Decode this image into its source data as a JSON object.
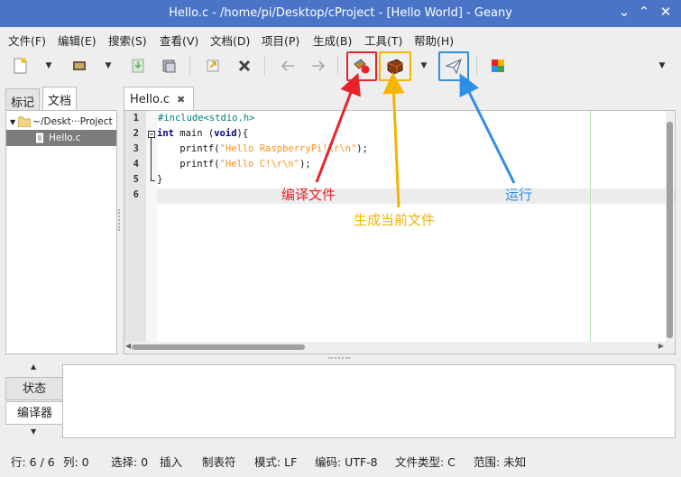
{
  "window": {
    "title": "Hello.c - /home/pi/Desktop/cProject - [Hello World] - Geany",
    "controls": [
      "⌄",
      "⌃",
      "✕"
    ]
  },
  "menu": [
    "文件(F)",
    "编辑(E)",
    "搜索(S)",
    "查看(V)",
    "文档(D)",
    "项目(P)",
    "生成(B)",
    "工具(T)",
    "帮助(H)"
  ],
  "toolbar": {
    "icons": [
      "new-file-icon",
      "open-file-icon",
      "save-icon",
      "save-all-icon",
      "revert-icon",
      "close-file-icon",
      "back-arrow-icon",
      "forward-arrow-icon",
      "compile-icon",
      "build-icon",
      "run-icon",
      "color-chooser-icon"
    ],
    "highlight_colors": {
      "compile": "#e8232b",
      "build": "#f4b400",
      "run": "#2e8fe6"
    }
  },
  "sidebar": {
    "tabs": [
      "标记",
      "文档"
    ],
    "tree": {
      "folder": "~/Deskt···Project",
      "file": "Hello.c"
    }
  },
  "editor": {
    "tab_label": "Hello.c",
    "close_glyph": "✖",
    "line_numbers": [
      "1",
      "2",
      "3",
      "4",
      "5",
      "6"
    ],
    "lines": {
      "l1": "#include<stdio.h>",
      "l2_kw": "int",
      "l2_mid": " main (",
      "l2_kw2": "void",
      "l2_end": "){",
      "l3_pre": "    printf(",
      "l3_str": "\"Hello RaspberryPi!\\r\\n\"",
      "l3_end": ");",
      "l4_pre": "    printf(",
      "l4_str": "\"Hello C!\\r\\n\"",
      "l4_end": ");",
      "l5": "}"
    }
  },
  "messages": {
    "tabs": [
      "状态",
      "编译器"
    ]
  },
  "statusbar": {
    "line": "行: 6 / 6",
    "col": "列: 0",
    "sel": "选择: 0",
    "insert": "插入",
    "tabs": "制表符",
    "mode": "模式: LF",
    "encoding": "编码: UTF-8",
    "filetype": "文件类型: C",
    "scope": "范围: 未知"
  },
  "annotations": {
    "compile": "编译文件",
    "build": "生成当前文件",
    "run": "运行"
  }
}
